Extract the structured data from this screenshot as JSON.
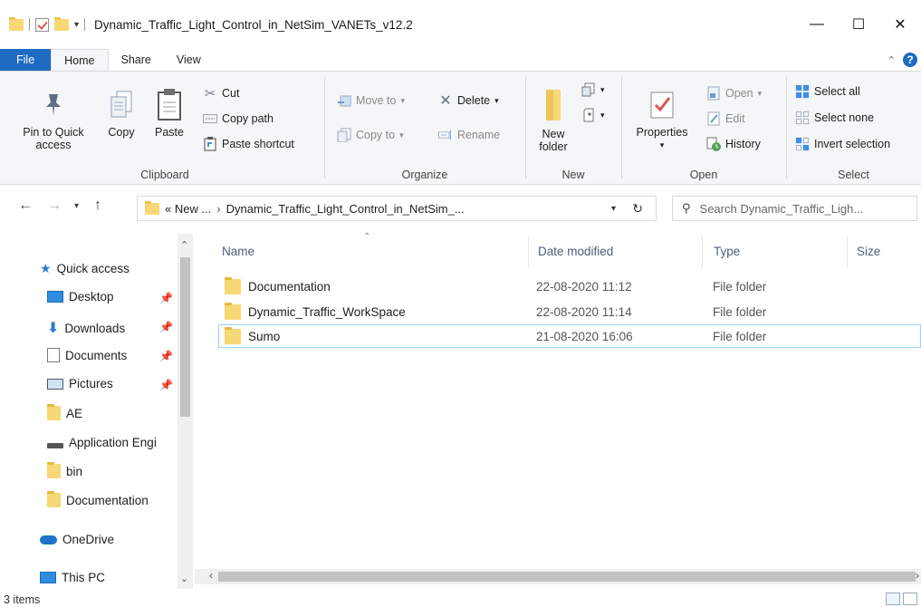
{
  "window": {
    "title": "Dynamic_Traffic_Light_Control_in_NetSim_VANETs_v12.2",
    "minimize": "—",
    "maximize": "☐",
    "close": "✕"
  },
  "ribbon_tabs": [
    "File",
    "Home",
    "Share",
    "View"
  ],
  "ribbon": {
    "clipboard": {
      "label": "Clipboard",
      "pin": "Pin to Quick access",
      "copy": "Copy",
      "paste": "Paste",
      "cut": "Cut",
      "copy_path": "Copy path",
      "paste_shortcut": "Paste shortcut"
    },
    "organize": {
      "label": "Organize",
      "move_to": "Move to",
      "copy_to": "Copy to",
      "delete": "Delete",
      "rename": "Rename"
    },
    "new": {
      "label": "New",
      "new_folder": "New folder"
    },
    "open": {
      "label": "Open",
      "properties": "Properties",
      "open": "Open",
      "edit": "Edit",
      "history": "History"
    },
    "select": {
      "label": "Select",
      "select_all": "Select all",
      "select_none": "Select none",
      "invert": "Invert selection"
    }
  },
  "address": {
    "path_prefix": "« New ...",
    "sep": "›",
    "path_current": "Dynamic_Traffic_Light_Control_in_NetSim_...",
    "search_placeholder": "Search Dynamic_Traffic_Ligh..."
  },
  "nav": {
    "items": [
      {
        "label": "Quick access",
        "icon": "star-icon"
      },
      {
        "label": "Desktop",
        "icon": "desktop-icon",
        "pinned": true
      },
      {
        "label": "Downloads",
        "icon": "download-icon",
        "pinned": true
      },
      {
        "label": "Documents",
        "icon": "documents-icon",
        "pinned": true
      },
      {
        "label": "Pictures",
        "icon": "pictures-icon",
        "pinned": true
      },
      {
        "label": "AE",
        "icon": "folder-icon"
      },
      {
        "label": "Application Engi",
        "icon": "drive-icon"
      },
      {
        "label": "bin",
        "icon": "folder-icon"
      },
      {
        "label": "Documentation",
        "icon": "folder-icon"
      },
      {
        "label": "OneDrive",
        "icon": "cloud-icon"
      },
      {
        "label": "This PC",
        "icon": "pc-icon"
      }
    ]
  },
  "columns": {
    "name": "Name",
    "date": "Date modified",
    "type": "Type",
    "size": "Size"
  },
  "files": [
    {
      "name": "Documentation",
      "date": "22-08-2020 11:12",
      "type": "File folder"
    },
    {
      "name": "Dynamic_Traffic_WorkSpace",
      "date": "22-08-2020 11:14",
      "type": "File folder"
    },
    {
      "name": "Sumo",
      "date": "21-08-2020 16:06",
      "type": "File folder"
    }
  ],
  "status": {
    "count": "3 items"
  },
  "colors": {
    "file_tab": "#1f6bc1",
    "selection_border": "#99d1ff",
    "folder": "#f8d775"
  }
}
